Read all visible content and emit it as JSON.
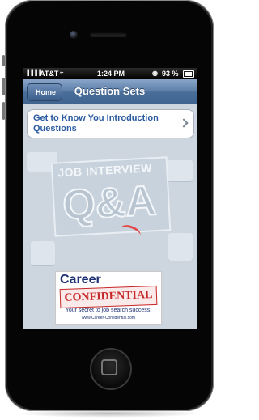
{
  "status": {
    "carrier": "AT&T",
    "signal": "▐▐▐▐",
    "time": "1:24 PM",
    "battery": "93 %"
  },
  "nav": {
    "back_label": "Home",
    "title": "Question Sets"
  },
  "list": [
    {
      "label": "Get to Know You Introduction Questions"
    }
  ],
  "background_art": {
    "line1": "JOB INTERVIEW",
    "line2": "Q&A"
  },
  "logo": {
    "career": "Career",
    "confidential": "CONFIDENTIAL",
    "tagline": "Your secret to job search success!",
    "url": "www.Career-Confidential.com"
  },
  "colors": {
    "nav_bar": "#4b6f9b",
    "link_text": "#2a5aa0",
    "brand_red": "#c62a2a",
    "brand_blue": "#1d2f73"
  }
}
